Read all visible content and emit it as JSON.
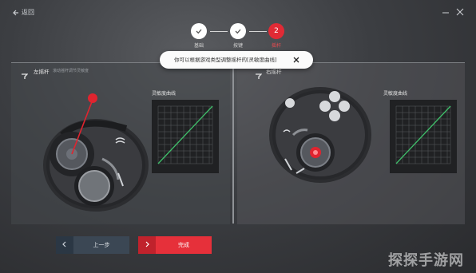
{
  "topbar": {
    "back_icon": "back-arrow-icon",
    "back_label": "返回",
    "minimize_icon": "minimize-icon",
    "close_icon": "close-icon"
  },
  "steps": [
    {
      "label": "基础",
      "state": "done",
      "icon": "check-icon"
    },
    {
      "label": "按键",
      "state": "done",
      "icon": "check-icon"
    },
    {
      "label": "摇杆",
      "state": "active",
      "number": "2"
    }
  ],
  "tooltip": {
    "text": "你可以根据游戏类型调整摇杆的[灵敏度曲线]",
    "close_icon": "close-icon"
  },
  "left_panel": {
    "title": "左摇杆",
    "subtitle": "滚动摇杆调节灵敏度",
    "curve_title": "灵敏度曲线",
    "stick_icon": "joystick-icon"
  },
  "right_panel": {
    "title": "右摇杆",
    "curve_title": "灵敏度曲线",
    "stick_icon": "joystick-icon"
  },
  "buttons": {
    "prev_label": "上一步",
    "next_label": "完成"
  },
  "colors": {
    "accent_red": "#e6303a",
    "curve_green": "#3fbf6a",
    "prev_button": "#3b4754"
  },
  "watermark": "探探手游网"
}
